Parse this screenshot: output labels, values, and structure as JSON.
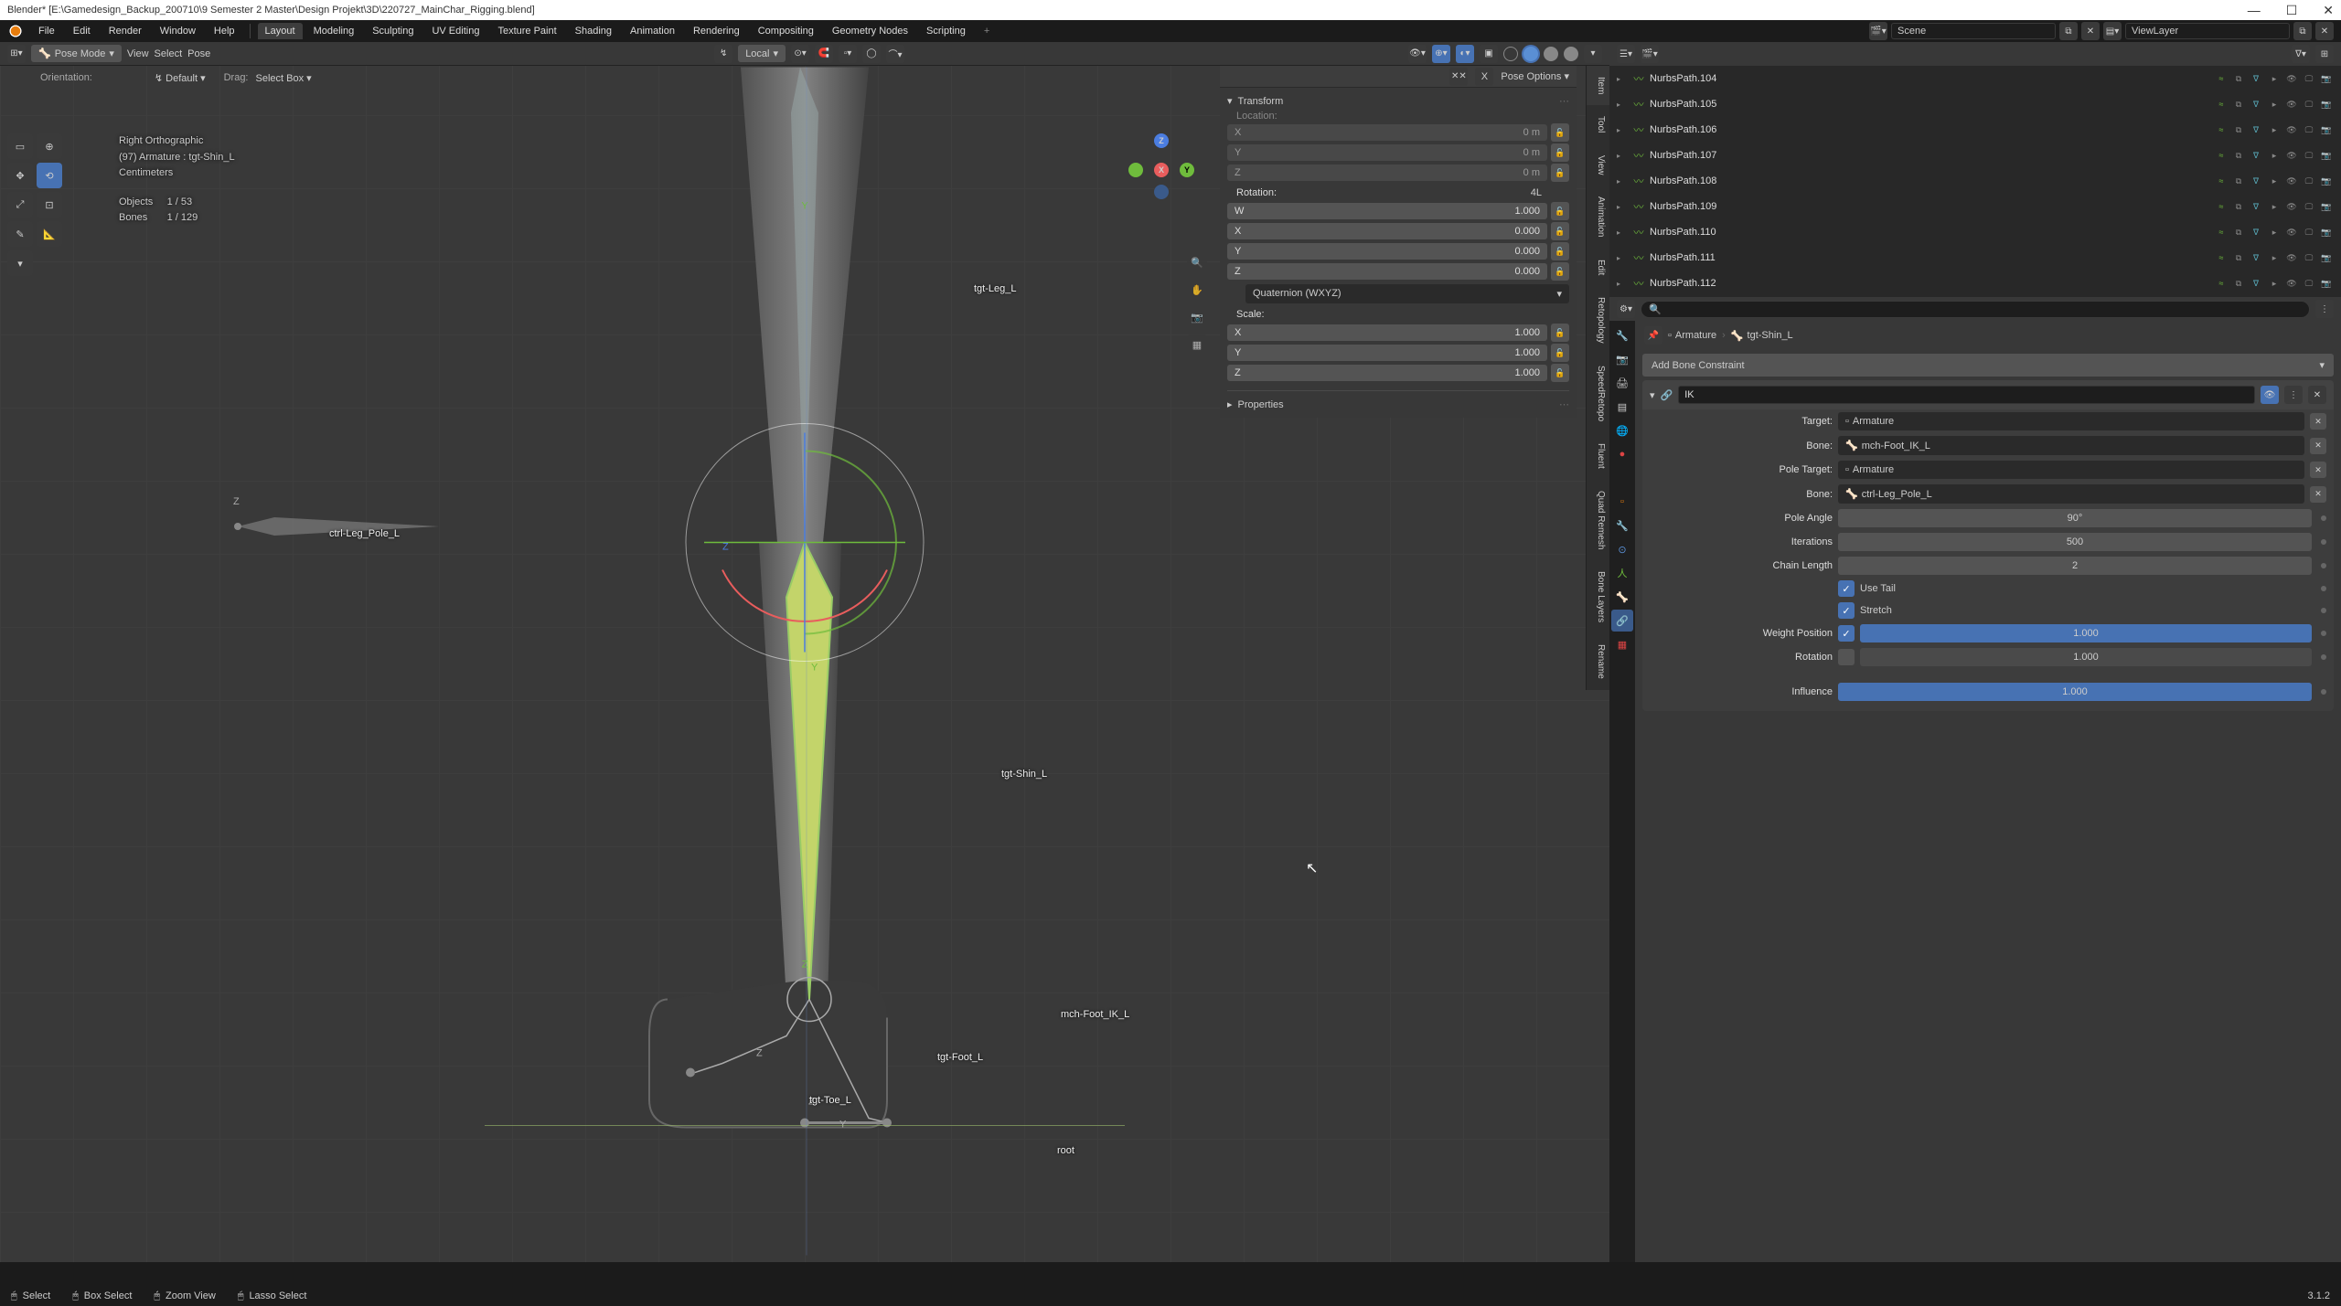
{
  "title": "Blender* [E:\\Gamedesign_Backup_200710\\9 Semester 2 Master\\Design Projekt\\3D\\220727_MainChar_Rigging.blend]",
  "menu": {
    "file": "File",
    "edit": "Edit",
    "render": "Render",
    "window": "Window",
    "help": "Help"
  },
  "workspaces": [
    "Layout",
    "Modeling",
    "Sculpting",
    "UV Editing",
    "Texture Paint",
    "Shading",
    "Animation",
    "Rendering",
    "Compositing",
    "Geometry Nodes",
    "Scripting"
  ],
  "scene": {
    "label": "Scene",
    "viewlayer": "ViewLayer"
  },
  "header": {
    "mode": "Pose Mode",
    "view": "View",
    "select": "Select",
    "pose": "Pose",
    "orient": "Local"
  },
  "hdr2": {
    "orientation": "Orientation:",
    "orient_val": "Default",
    "drag": "Drag:",
    "drag_val": "Select Box",
    "xmirror": "X",
    "poseopts": "Pose Options"
  },
  "overlay": {
    "view": "Right Orthographic",
    "obj": "(97) Armature : tgt-Shin_L",
    "units": "Centimeters",
    "objects": "Objects",
    "objects_v": "1 / 53",
    "bones": "Bones",
    "bones_v": "1 / 129"
  },
  "bones": {
    "leg": "tgt-Leg_L",
    "shin": "tgt-Shin_L",
    "foot": "tgt-Foot_L",
    "toe": "tgt-Toe_L",
    "footik": "mch-Foot_IK_L",
    "pole": "ctrl-Leg_Pole_L",
    "root": "root"
  },
  "npanel": {
    "transform": "Transform",
    "location": "Location:",
    "rotation": "Rotation:",
    "rotmode": "4L",
    "scale": "Scale:",
    "loc": {
      "x": "0 m",
      "y": "0 m",
      "z": "0 m"
    },
    "rot": {
      "w": "1.000",
      "x": "0.000",
      "y": "0.000",
      "z": "0.000"
    },
    "mode": "Quaternion (WXYZ)",
    "scl": {
      "x": "1.000",
      "y": "1.000",
      "z": "1.000"
    },
    "properties": "Properties"
  },
  "ntabs": [
    "Item",
    "Tool",
    "View",
    "Animation",
    "Edit",
    "Retopology",
    "SpeedRetopo",
    "Fluent",
    "Quad Remesh",
    "Bone Layers",
    "Rename"
  ],
  "outliner": {
    "items": [
      {
        "n": "NurbsPath.104"
      },
      {
        "n": "NurbsPath.105"
      },
      {
        "n": "NurbsPath.106"
      },
      {
        "n": "NurbsPath.107"
      },
      {
        "n": "NurbsPath.108"
      },
      {
        "n": "NurbsPath.109"
      },
      {
        "n": "NurbsPath.110"
      },
      {
        "n": "NurbsPath.111"
      },
      {
        "n": "NurbsPath.112"
      }
    ]
  },
  "props": {
    "bc_arm": "Armature",
    "bc_bone": "tgt-Shin_L",
    "add": "Add Bone Constraint",
    "cname": "IK",
    "target": "Target:",
    "target_v": "Armature",
    "bone": "Bone:",
    "bone_v": "mch-Foot_IK_L",
    "ptarget": "Pole Target:",
    "ptarget_v": "Armature",
    "pbone": "Bone:",
    "pbone_v": "ctrl-Leg_Pole_L",
    "pangle": "Pole Angle",
    "pangle_v": "90°",
    "iter": "Iterations",
    "iter_v": "500",
    "chain": "Chain Length",
    "chain_v": "2",
    "usetail": "Use Tail",
    "stretch": "Stretch",
    "wpos": "Weight Position",
    "wpos_v": "1.000",
    "rotc": "Rotation",
    "rotc_v": "1.000",
    "infl": "Influence",
    "infl_v": "1.000"
  },
  "status": {
    "select": "Select",
    "box": "Box Select",
    "zoom": "Zoom View",
    "lasso": "Lasso Select",
    "ver": "3.1.2"
  },
  "chart_data": null
}
